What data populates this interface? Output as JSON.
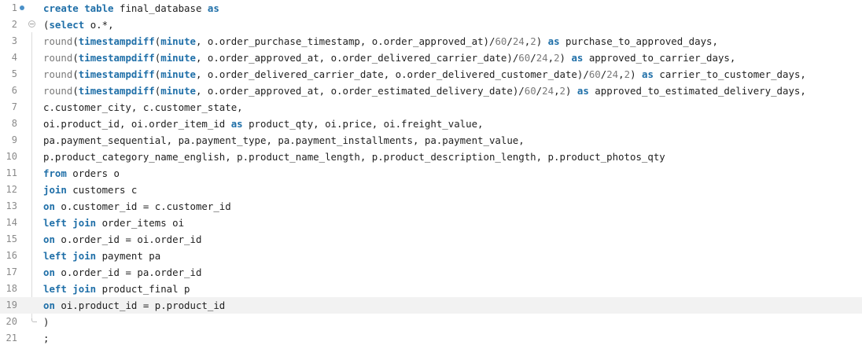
{
  "editor": {
    "lines": [
      {
        "num": "1",
        "parts": [
          [
            "kw",
            "create table"
          ],
          [
            "tx",
            " final_database "
          ],
          [
            "kw",
            "as"
          ]
        ]
      },
      {
        "num": "2",
        "parts": [
          [
            "tx",
            "("
          ],
          [
            "kw",
            "select"
          ],
          [
            "tx",
            " o.*,"
          ]
        ]
      },
      {
        "num": "3",
        "parts": [
          [
            "fn",
            "round"
          ],
          [
            "tx",
            "("
          ],
          [
            "kw",
            "timestampdiff"
          ],
          [
            "tx",
            "("
          ],
          [
            "kw",
            "minute"
          ],
          [
            "tx",
            ", o.order_purchase_timestamp, o.order_approved_at)/"
          ],
          [
            "num",
            "60"
          ],
          [
            "tx",
            "/"
          ],
          [
            "num",
            "24"
          ],
          [
            "tx",
            ","
          ],
          [
            "num",
            "2"
          ],
          [
            "tx",
            ") "
          ],
          [
            "kw",
            "as"
          ],
          [
            "tx",
            " purchase_to_approved_days,"
          ]
        ]
      },
      {
        "num": "4",
        "parts": [
          [
            "fn",
            "round"
          ],
          [
            "tx",
            "("
          ],
          [
            "kw",
            "timestampdiff"
          ],
          [
            "tx",
            "("
          ],
          [
            "kw",
            "minute"
          ],
          [
            "tx",
            ", o.order_approved_at, o.order_delivered_carrier_date)/"
          ],
          [
            "num",
            "60"
          ],
          [
            "tx",
            "/"
          ],
          [
            "num",
            "24"
          ],
          [
            "tx",
            ","
          ],
          [
            "num",
            "2"
          ],
          [
            "tx",
            ") "
          ],
          [
            "kw",
            "as"
          ],
          [
            "tx",
            " approved_to_carrier_days,"
          ]
        ]
      },
      {
        "num": "5",
        "parts": [
          [
            "fn",
            "round"
          ],
          [
            "tx",
            "("
          ],
          [
            "kw",
            "timestampdiff"
          ],
          [
            "tx",
            "("
          ],
          [
            "kw",
            "minute"
          ],
          [
            "tx",
            ", o.order_delivered_carrier_date, o.order_delivered_customer_date)/"
          ],
          [
            "num",
            "60"
          ],
          [
            "tx",
            "/"
          ],
          [
            "num",
            "24"
          ],
          [
            "tx",
            ","
          ],
          [
            "num",
            "2"
          ],
          [
            "tx",
            ") "
          ],
          [
            "kw",
            "as"
          ],
          [
            "tx",
            " carrier_to_customer_days,"
          ]
        ]
      },
      {
        "num": "6",
        "parts": [
          [
            "fn",
            "round"
          ],
          [
            "tx",
            "("
          ],
          [
            "kw",
            "timestampdiff"
          ],
          [
            "tx",
            "("
          ],
          [
            "kw",
            "minute"
          ],
          [
            "tx",
            ", o.order_approved_at, o.order_estimated_delivery_date)/"
          ],
          [
            "num",
            "60"
          ],
          [
            "tx",
            "/"
          ],
          [
            "num",
            "24"
          ],
          [
            "tx",
            ","
          ],
          [
            "num",
            "2"
          ],
          [
            "tx",
            ") "
          ],
          [
            "kw",
            "as"
          ],
          [
            "tx",
            " approved_to_estimated_delivery_days,"
          ]
        ]
      },
      {
        "num": "7",
        "parts": [
          [
            "tx",
            "c.customer_city, c.customer_state,"
          ]
        ]
      },
      {
        "num": "8",
        "parts": [
          [
            "tx",
            "oi.product_id, oi.order_item_id "
          ],
          [
            "kw",
            "as"
          ],
          [
            "tx",
            " product_qty, oi.price, oi.freight_value,"
          ]
        ]
      },
      {
        "num": "9",
        "parts": [
          [
            "tx",
            "pa.payment_sequential, pa.payment_type, pa.payment_installments, pa.payment_value,"
          ]
        ]
      },
      {
        "num": "10",
        "parts": [
          [
            "tx",
            "p.product_category_name_english, p.product_name_length, p.product_description_length, p.product_photos_qty"
          ]
        ]
      },
      {
        "num": "11",
        "parts": [
          [
            "kw",
            "from"
          ],
          [
            "tx",
            " orders o"
          ]
        ]
      },
      {
        "num": "12",
        "parts": [
          [
            "kw",
            "join"
          ],
          [
            "tx",
            " customers c"
          ]
        ]
      },
      {
        "num": "13",
        "parts": [
          [
            "kw",
            "on"
          ],
          [
            "tx",
            " o.customer_id = c.customer_id"
          ]
        ]
      },
      {
        "num": "14",
        "parts": [
          [
            "kw",
            "left join"
          ],
          [
            "tx",
            " order_items oi"
          ]
        ]
      },
      {
        "num": "15",
        "parts": [
          [
            "kw",
            "on"
          ],
          [
            "tx",
            " o.order_id = oi.order_id"
          ]
        ]
      },
      {
        "num": "16",
        "parts": [
          [
            "kw",
            "left join"
          ],
          [
            "tx",
            " payment pa"
          ]
        ]
      },
      {
        "num": "17",
        "parts": [
          [
            "kw",
            "on"
          ],
          [
            "tx",
            " o.order_id = pa.order_id"
          ]
        ]
      },
      {
        "num": "18",
        "parts": [
          [
            "kw",
            "left join"
          ],
          [
            "tx",
            " product_final p"
          ]
        ]
      },
      {
        "num": "19",
        "parts": [
          [
            "kw",
            "on"
          ],
          [
            "tx",
            " oi.product_id = p.product_id"
          ]
        ]
      },
      {
        "num": "20",
        "parts": [
          [
            "tx",
            ")"
          ]
        ]
      },
      {
        "num": "21",
        "parts": [
          [
            "tx",
            ";"
          ]
        ]
      }
    ],
    "current_line": 19,
    "marker_line": 1,
    "fold_start_line": 2,
    "fold_end_line": 20,
    "colors": {
      "keyword": "#1f6fa8",
      "function": "#7a7a7a",
      "number": "#7a7a7a",
      "text": "#1f1f1f",
      "line_number": "#8a8a8a",
      "current_line_bg": "#f2f2f2",
      "marker": "#4a90c8"
    }
  }
}
